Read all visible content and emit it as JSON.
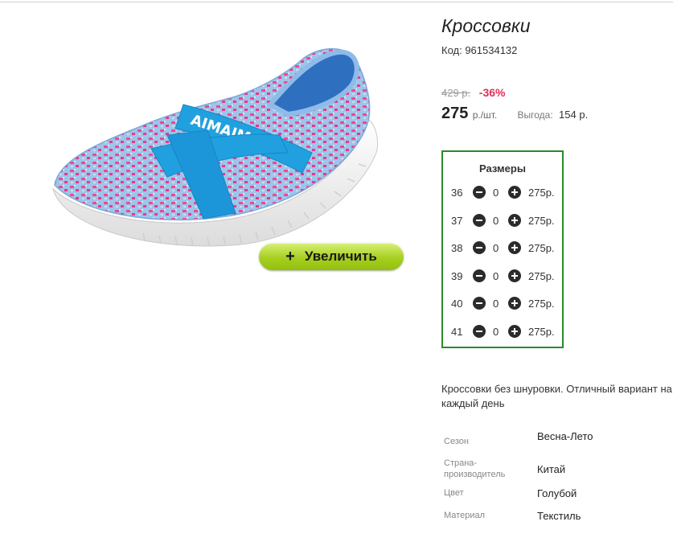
{
  "product": {
    "title": "Кроссовки",
    "code": "Код: 961534132",
    "old_price": "429 р.",
    "discount": "-36%",
    "price": "275",
    "price_unit": "р./шт.",
    "savings_label": "Выгода:",
    "savings_value": "154 р.",
    "zoom_label": "Увеличить",
    "zoom_icon": "+"
  },
  "sizes": {
    "title": "Размеры",
    "rows": [
      {
        "size": "36",
        "qty": "0",
        "price": "275р."
      },
      {
        "size": "37",
        "qty": "0",
        "price": "275р."
      },
      {
        "size": "38",
        "qty": "0",
        "price": "275р."
      },
      {
        "size": "39",
        "qty": "0",
        "price": "275р."
      },
      {
        "size": "40",
        "qty": "0",
        "price": "275р."
      },
      {
        "size": "41",
        "qty": "0",
        "price": "275р."
      }
    ]
  },
  "description": "Кроссовки без шнуровки. Отличный вариант на каждый день",
  "attributes": [
    {
      "label": "Сезон",
      "value": "Весна-Лето"
    },
    {
      "label": "Страна-производитель",
      "value": "Китай"
    },
    {
      "label": "Цвет",
      "value": "Голубой"
    },
    {
      "label": "Материал",
      "value": "Текстиль"
    }
  ],
  "colors": {
    "size_box_border": "#2a8a2a",
    "discount": "#e0305a",
    "zoom_button": "#a6cf1f"
  }
}
